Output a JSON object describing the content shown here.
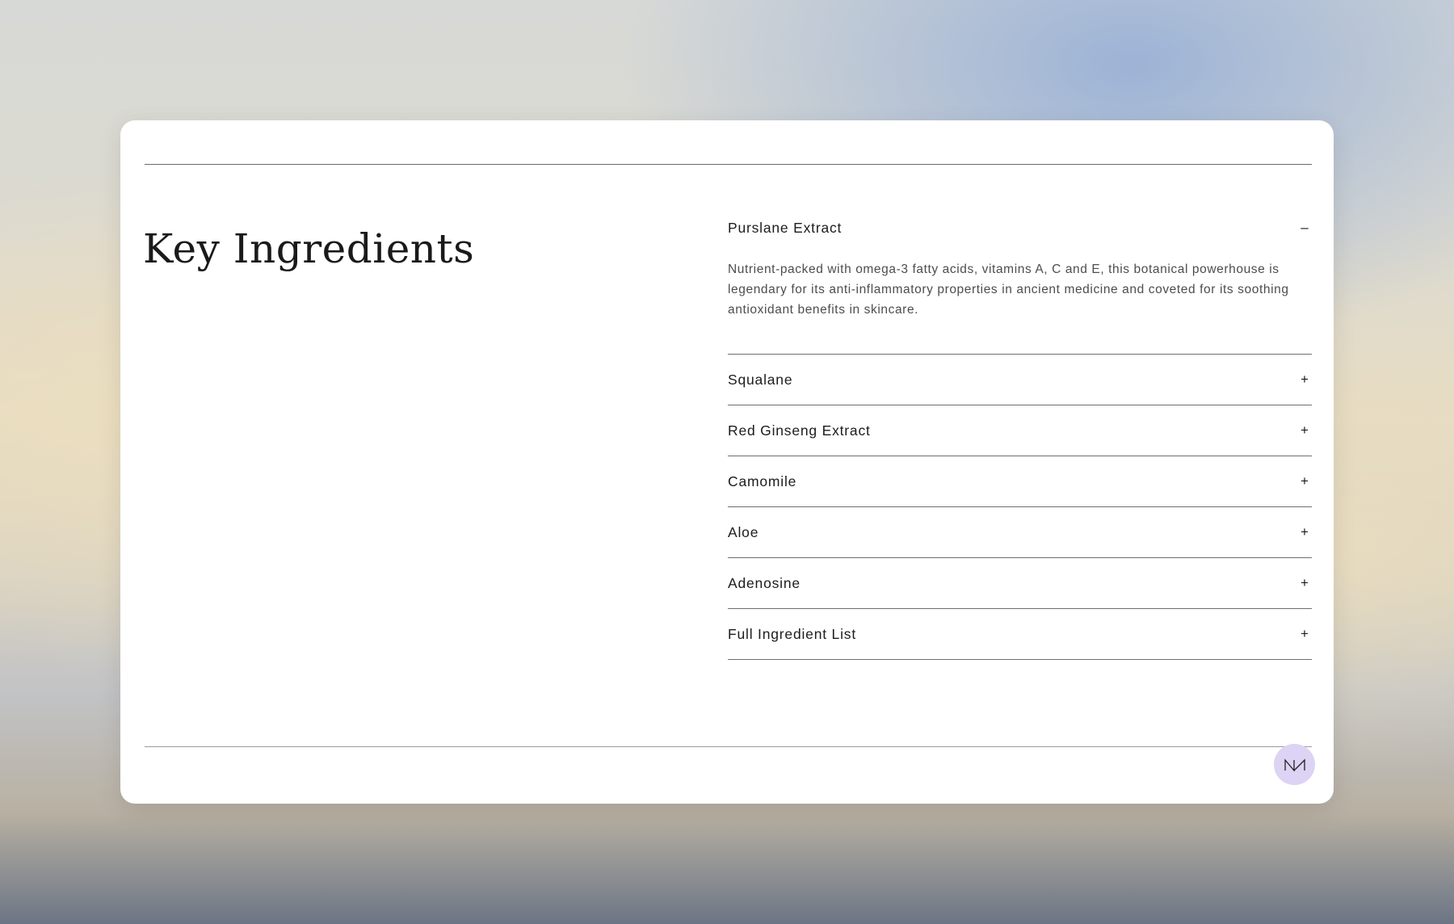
{
  "section": {
    "title": "Key Ingredients"
  },
  "accordion": {
    "items": [
      {
        "label": "Purslane Extract",
        "toggle": "–",
        "expanded": true,
        "description": "Nutrient-packed with omega-3 fatty acids, vitamins A, C and E, this botanical powerhouse is legendary for its anti-inflammatory properties in ancient medicine and coveted for its soothing antioxidant benefits in skincare."
      },
      {
        "label": "Squalane",
        "toggle": "+",
        "expanded": false
      },
      {
        "label": "Red Ginseng Extract",
        "toggle": "+",
        "expanded": false
      },
      {
        "label": "Camomile",
        "toggle": "+",
        "expanded": false
      },
      {
        "label": "Aloe",
        "toggle": "+",
        "expanded": false
      },
      {
        "label": "Adenosine",
        "toggle": "+",
        "expanded": false
      },
      {
        "label": "Full Ingredient List",
        "toggle": "+",
        "expanded": false
      }
    ]
  },
  "logo_badge": {
    "icon": "nm-monogram-icon",
    "color": "#ddd3f5"
  }
}
